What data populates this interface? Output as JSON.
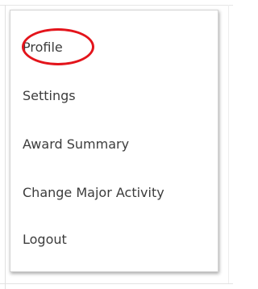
{
  "menu": {
    "items": [
      {
        "label": "Profile"
      },
      {
        "label": "Settings"
      },
      {
        "label": "Award Summary"
      },
      {
        "label": "Change Major Activity"
      },
      {
        "label": "Logout"
      }
    ],
    "highlighted_item": "Profile"
  },
  "colors": {
    "highlight": "#e3141b",
    "text": "#3c3c3c",
    "background": "#ffffff"
  }
}
